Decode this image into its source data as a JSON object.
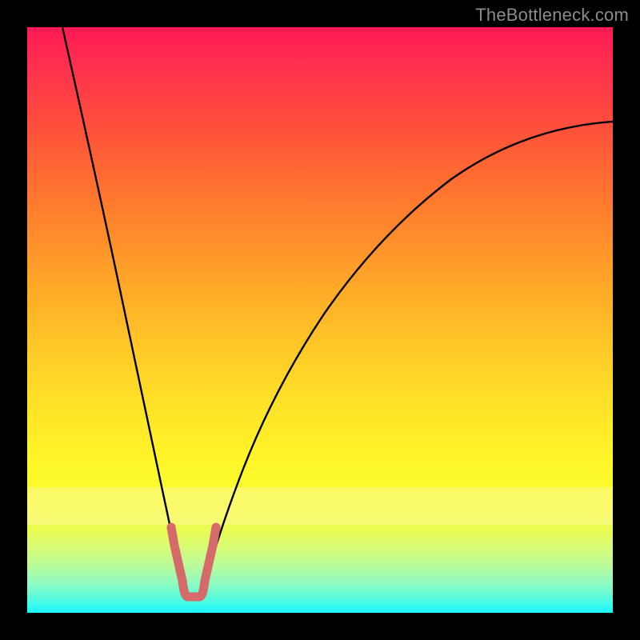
{
  "watermark": "TheBottleneck.com",
  "chart_data": {
    "type": "line",
    "title": "",
    "xlabel": "",
    "ylabel": "",
    "xlim": [
      0,
      100
    ],
    "ylim": [
      0,
      100
    ],
    "grid": false,
    "legend": false,
    "background_gradient": {
      "top": "#ff1a55",
      "mid": "#ffe128",
      "bottom": "#18f9fb"
    },
    "highlight_band_y": [
      0,
      15
    ],
    "sweet_spot_x": [
      24,
      31
    ],
    "series": [
      {
        "name": "left-curve",
        "color": "#000000",
        "x": [
          6,
          8,
          10,
          12,
          14,
          16,
          18,
          20,
          22,
          24,
          25,
          26
        ],
        "y": [
          100,
          86,
          73,
          61,
          50,
          41,
          33,
          26,
          19,
          12,
          8,
          4
        ]
      },
      {
        "name": "right-curve",
        "color": "#000000",
        "x": [
          29,
          30,
          32,
          34,
          37,
          40,
          44,
          48,
          53,
          58,
          64,
          70,
          77,
          84,
          91,
          100
        ],
        "y": [
          4,
          8,
          14,
          20,
          27,
          33,
          40,
          46,
          52,
          58,
          63,
          68,
          72,
          76,
          79,
          82
        ]
      },
      {
        "name": "valley-marker",
        "color": "#d46a6a",
        "x": [
          24,
          25,
          26,
          27,
          28,
          29,
          30,
          31
        ],
        "y": [
          12,
          8,
          4,
          2,
          2,
          4,
          8,
          14
        ]
      }
    ]
  }
}
